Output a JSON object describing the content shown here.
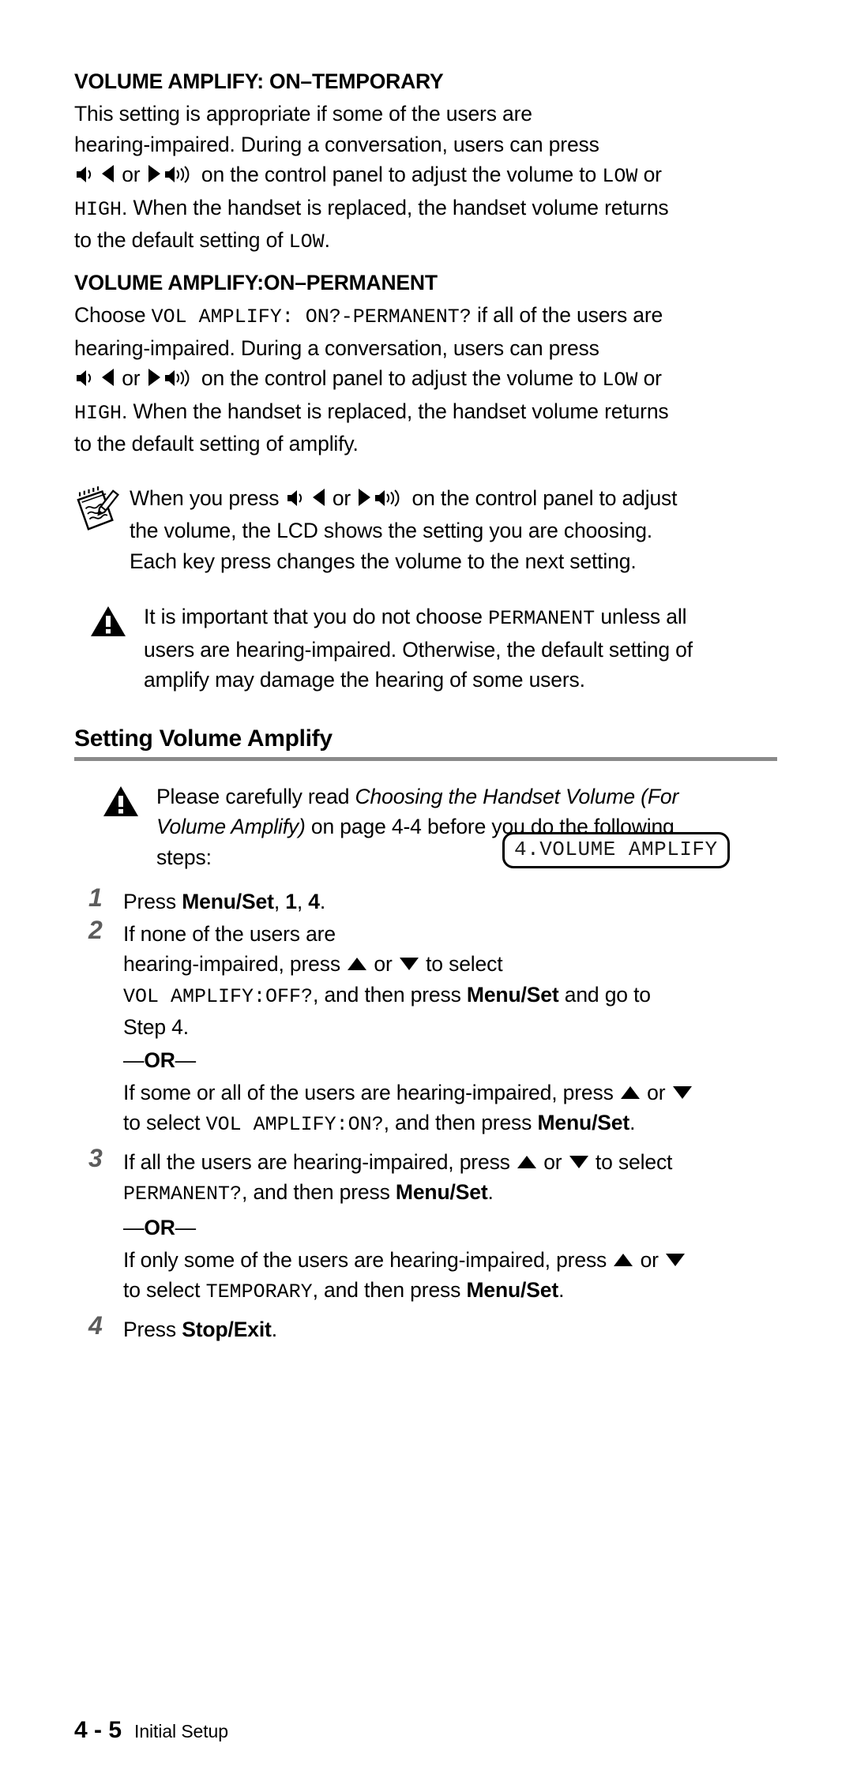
{
  "document": {
    "sections": [
      {
        "heading": "VOLUME AMPLIFY: ON–TEMPORARY",
        "para_line1": "This setting is appropriate if some of the users are",
        "para_line2": "hearing-impaired. During a conversation, users can press",
        "para_line3_or": "or",
        "para_line3_mid": "on the control panel to adjust the volume to",
        "para_low": "LOW",
        "para_line3_end": "or",
        "para_high": "HIGH",
        "para_line4": ". When the handset is replaced, the handset volume returns",
        "para_line5": "to the default setting of",
        "para_low2": "LOW",
        "para_line5_end": "."
      },
      {
        "heading": "VOLUME AMPLIFY:ON–PERMANENT",
        "choose_label": "Choose",
        "choose_mono": "VOL AMPLIFY: ON?-PERMANENT?",
        "choose_rest": "if all of the users are",
        "para_line2": "hearing-impaired. During a conversation, users can press",
        "para_line3_or": "or",
        "para_line3_mid": "on the control panel to adjust the volume to",
        "para_low": "LOW",
        "para_line3_end": "or",
        "para_high": "HIGH",
        "para_line4": ". When the handset is replaced, the handset volume returns",
        "para_line5": "to the default setting of amplify."
      }
    ],
    "note": {
      "icon": "notepad-pencil-icon",
      "line1_a": "When you press",
      "line1_or": "or",
      "line1_b": "on the control panel to adjust",
      "line2": "the volume, the LCD shows the setting you are choosing.",
      "line3": "Each key press changes the volume to the next setting."
    },
    "caution": {
      "icon": "warning-triangle-icon",
      "line1_a": "It is important that you do not choose",
      "line1_mono": "PERMANENT",
      "line1_b": "unless all",
      "line2": "users are hearing-impaired. Otherwise, the default setting of",
      "line3": "amplify may damage the hearing of some users."
    },
    "section_heading": "Setting Volume Amplify",
    "procedure_caution": {
      "icon": "warning-triangle-icon",
      "line1_a": "Please carefully read",
      "line1_italic": "Choosing the Handset Volume (For",
      "line2_italic": "Volume Amplify)",
      "line2_b": "on page 4-4 before you do the following",
      "line3": "steps:"
    },
    "steps": [
      {
        "number": "1",
        "text_a": "Press",
        "text_bold1": "Menu/Set",
        "text_comma1": ",",
        "text_bold2": "1",
        "text_comma2": ",",
        "text_bold3": "4",
        "text_end": "."
      },
      {
        "number": "2",
        "line1": "If none of the users are",
        "line2_a": "hearing-impaired, press",
        "line2_or": "or",
        "line2_b": "to select",
        "line3_mono": "VOL AMPLIFY:OFF?",
        "line3_a": ", and then press",
        "line3_bold": "Menu/Set",
        "line3_b": "and go to",
        "line4": "Step 4.",
        "or_separator": "OR",
        "alt_line1_a": "If some or all of the users are hearing-impaired, press",
        "alt_line1_or": "or",
        "alt_line2_a": "to select",
        "alt_line2_mono": "VOL AMPLIFY:ON?",
        "alt_line2_b": ", and then press",
        "alt_line2_bold": "Menu/Set",
        "alt_line2_end": "."
      },
      {
        "number": "3",
        "line1_a": "If all the users are hearing-impaired, press",
        "line1_or": "or",
        "line1_b": "to select",
        "line2_mono": "PERMANENT?",
        "line2_a": ", and then press",
        "line2_bold": "Menu/Set",
        "line2_end": ".",
        "or_separator": "OR",
        "alt_line1_a": "If only some of the users are hearing-impaired, press",
        "alt_line1_or": "or",
        "alt_line2_a": "to select",
        "alt_line2_mono": "TEMPORARY",
        "alt_line2_b": ", and then press",
        "alt_line2_bold": "Menu/Set",
        "alt_line2_end": "."
      },
      {
        "number": "4",
        "text_a": "Press",
        "text_bold": "Stop/Exit",
        "text_end": "."
      }
    ],
    "lcd_callout": {
      "text": "4.VOLUME AMPLIFY"
    },
    "footer": {
      "page_number": "4 - 5",
      "chapter_label": "Initial Setup"
    },
    "colors": {
      "rule": "#8a8a8a",
      "step_number": "#5c5c5c",
      "text": "#000000",
      "background": "#ffffff"
    }
  }
}
